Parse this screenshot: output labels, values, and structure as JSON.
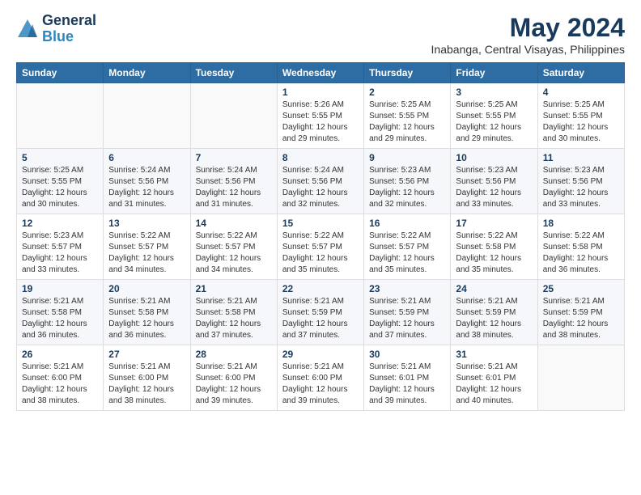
{
  "logo": {
    "line1": "General",
    "line2": "Blue"
  },
  "title": "May 2024",
  "subtitle": "Inabanga, Central Visayas, Philippines",
  "weekdays": [
    "Sunday",
    "Monday",
    "Tuesday",
    "Wednesday",
    "Thursday",
    "Friday",
    "Saturday"
  ],
  "weeks": [
    [
      {
        "day": "",
        "info": ""
      },
      {
        "day": "",
        "info": ""
      },
      {
        "day": "",
        "info": ""
      },
      {
        "day": "1",
        "info": "Sunrise: 5:26 AM\nSunset: 5:55 PM\nDaylight: 12 hours\nand 29 minutes."
      },
      {
        "day": "2",
        "info": "Sunrise: 5:25 AM\nSunset: 5:55 PM\nDaylight: 12 hours\nand 29 minutes."
      },
      {
        "day": "3",
        "info": "Sunrise: 5:25 AM\nSunset: 5:55 PM\nDaylight: 12 hours\nand 29 minutes."
      },
      {
        "day": "4",
        "info": "Sunrise: 5:25 AM\nSunset: 5:55 PM\nDaylight: 12 hours\nand 30 minutes."
      }
    ],
    [
      {
        "day": "5",
        "info": "Sunrise: 5:25 AM\nSunset: 5:55 PM\nDaylight: 12 hours\nand 30 minutes."
      },
      {
        "day": "6",
        "info": "Sunrise: 5:24 AM\nSunset: 5:56 PM\nDaylight: 12 hours\nand 31 minutes."
      },
      {
        "day": "7",
        "info": "Sunrise: 5:24 AM\nSunset: 5:56 PM\nDaylight: 12 hours\nand 31 minutes."
      },
      {
        "day": "8",
        "info": "Sunrise: 5:24 AM\nSunset: 5:56 PM\nDaylight: 12 hours\nand 32 minutes."
      },
      {
        "day": "9",
        "info": "Sunrise: 5:23 AM\nSunset: 5:56 PM\nDaylight: 12 hours\nand 32 minutes."
      },
      {
        "day": "10",
        "info": "Sunrise: 5:23 AM\nSunset: 5:56 PM\nDaylight: 12 hours\nand 33 minutes."
      },
      {
        "day": "11",
        "info": "Sunrise: 5:23 AM\nSunset: 5:56 PM\nDaylight: 12 hours\nand 33 minutes."
      }
    ],
    [
      {
        "day": "12",
        "info": "Sunrise: 5:23 AM\nSunset: 5:57 PM\nDaylight: 12 hours\nand 33 minutes."
      },
      {
        "day": "13",
        "info": "Sunrise: 5:22 AM\nSunset: 5:57 PM\nDaylight: 12 hours\nand 34 minutes."
      },
      {
        "day": "14",
        "info": "Sunrise: 5:22 AM\nSunset: 5:57 PM\nDaylight: 12 hours\nand 34 minutes."
      },
      {
        "day": "15",
        "info": "Sunrise: 5:22 AM\nSunset: 5:57 PM\nDaylight: 12 hours\nand 35 minutes."
      },
      {
        "day": "16",
        "info": "Sunrise: 5:22 AM\nSunset: 5:57 PM\nDaylight: 12 hours\nand 35 minutes."
      },
      {
        "day": "17",
        "info": "Sunrise: 5:22 AM\nSunset: 5:58 PM\nDaylight: 12 hours\nand 35 minutes."
      },
      {
        "day": "18",
        "info": "Sunrise: 5:22 AM\nSunset: 5:58 PM\nDaylight: 12 hours\nand 36 minutes."
      }
    ],
    [
      {
        "day": "19",
        "info": "Sunrise: 5:21 AM\nSunset: 5:58 PM\nDaylight: 12 hours\nand 36 minutes."
      },
      {
        "day": "20",
        "info": "Sunrise: 5:21 AM\nSunset: 5:58 PM\nDaylight: 12 hours\nand 36 minutes."
      },
      {
        "day": "21",
        "info": "Sunrise: 5:21 AM\nSunset: 5:58 PM\nDaylight: 12 hours\nand 37 minutes."
      },
      {
        "day": "22",
        "info": "Sunrise: 5:21 AM\nSunset: 5:59 PM\nDaylight: 12 hours\nand 37 minutes."
      },
      {
        "day": "23",
        "info": "Sunrise: 5:21 AM\nSunset: 5:59 PM\nDaylight: 12 hours\nand 37 minutes."
      },
      {
        "day": "24",
        "info": "Sunrise: 5:21 AM\nSunset: 5:59 PM\nDaylight: 12 hours\nand 38 minutes."
      },
      {
        "day": "25",
        "info": "Sunrise: 5:21 AM\nSunset: 5:59 PM\nDaylight: 12 hours\nand 38 minutes."
      }
    ],
    [
      {
        "day": "26",
        "info": "Sunrise: 5:21 AM\nSunset: 6:00 PM\nDaylight: 12 hours\nand 38 minutes."
      },
      {
        "day": "27",
        "info": "Sunrise: 5:21 AM\nSunset: 6:00 PM\nDaylight: 12 hours\nand 38 minutes."
      },
      {
        "day": "28",
        "info": "Sunrise: 5:21 AM\nSunset: 6:00 PM\nDaylight: 12 hours\nand 39 minutes."
      },
      {
        "day": "29",
        "info": "Sunrise: 5:21 AM\nSunset: 6:00 PM\nDaylight: 12 hours\nand 39 minutes."
      },
      {
        "day": "30",
        "info": "Sunrise: 5:21 AM\nSunset: 6:01 PM\nDaylight: 12 hours\nand 39 minutes."
      },
      {
        "day": "31",
        "info": "Sunrise: 5:21 AM\nSunset: 6:01 PM\nDaylight: 12 hours\nand 40 minutes."
      },
      {
        "day": "",
        "info": ""
      }
    ]
  ]
}
